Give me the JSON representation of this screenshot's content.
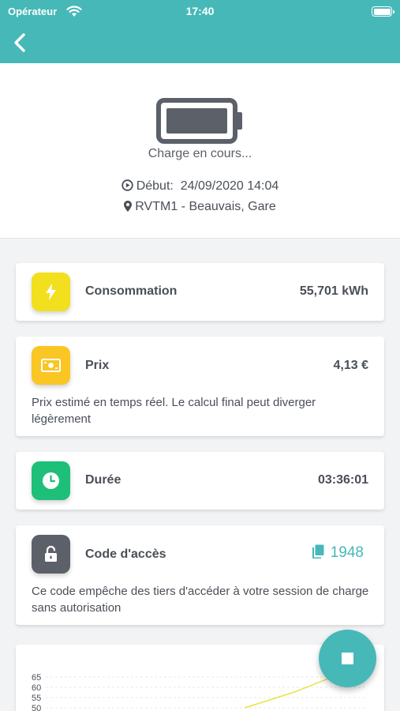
{
  "status_bar": {
    "carrier": "Opérateur",
    "time": "17:40"
  },
  "nav": {
    "back_icon": "chevron-left-icon"
  },
  "session": {
    "status": "Charge en cours...",
    "start_label": "Début:",
    "start_value": "24/09/2020 14:04",
    "location": "RVTM1 - Beauvais, Gare",
    "battery_level": 1.0
  },
  "cards": {
    "consumption": {
      "title": "Consommation",
      "value": "55,701 kWh",
      "icon": "lightning-icon",
      "color": "#f2e01f"
    },
    "price": {
      "title": "Prix",
      "value": "4,13 €",
      "description": "Prix estimé en temps réel. Le calcul final peut diverger légèrement",
      "icon": "banknote-icon",
      "color": "#f9c623"
    },
    "duration": {
      "title": "Durée",
      "value": "03:36:01",
      "icon": "clock-icon",
      "color": "#1ebf78"
    },
    "access_code": {
      "title": "Code d'accès",
      "value": "1948",
      "description": "Ce code empêche des tiers d'accéder à votre session de charge sans autorisation",
      "icon": "lock-open-icon",
      "copy_icon": "copy-icon",
      "color": "#5b6069"
    }
  },
  "chart_data": {
    "type": "line",
    "y_ticks": [
      "65",
      "60",
      "55",
      "50"
    ],
    "ylim": [
      50,
      65
    ],
    "series": [
      {
        "x": [
          0.62,
          0.78,
          0.9
        ],
        "values": [
          50,
          58,
          65.5
        ]
      }
    ],
    "line_color": "#e8e23a"
  },
  "fab": {
    "icon": "stop-icon",
    "color": "#46b8b8"
  }
}
